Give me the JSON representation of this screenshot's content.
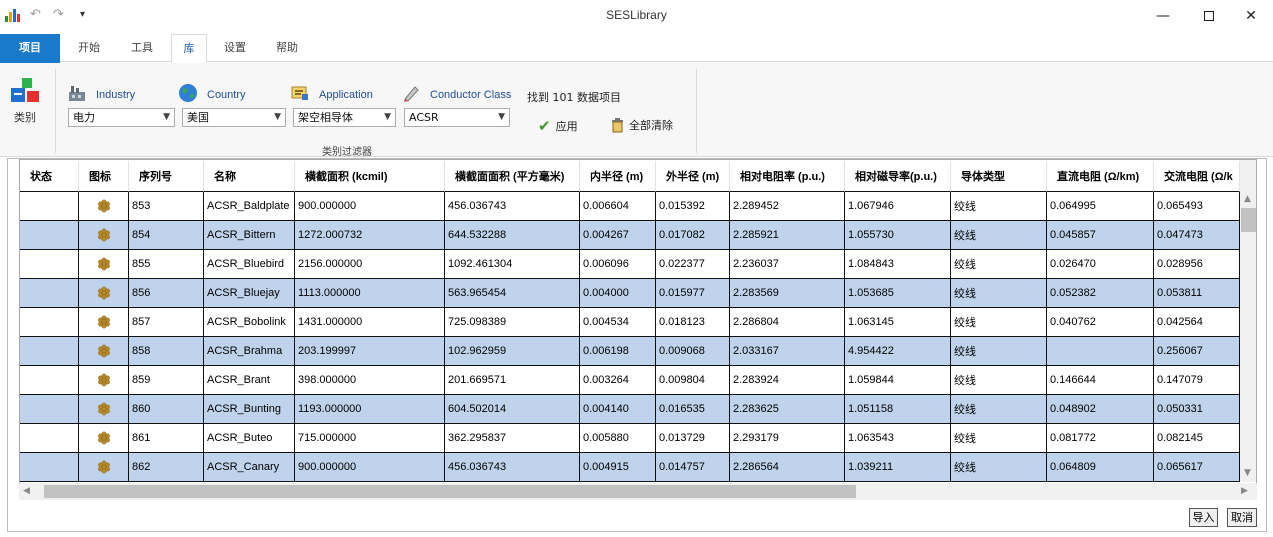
{
  "window": {
    "title": "SESLibrary",
    "minimize_icon": "minimize-icon",
    "maximize_icon": "maximize-icon",
    "close_icon": "close-icon"
  },
  "quick_access": {
    "undo_icon": "undo-icon",
    "redo_icon": "redo-icon",
    "customize_icon": "customize-icon"
  },
  "tabs": [
    {
      "label": "项目"
    },
    {
      "label": "开始"
    },
    {
      "label": "工具"
    },
    {
      "label": "库"
    },
    {
      "label": "设置"
    },
    {
      "label": "帮助"
    }
  ],
  "ribbon": {
    "category_label": "类别",
    "filters": [
      {
        "label": "Industry",
        "value": "电力",
        "icon": "factory-icon"
      },
      {
        "label": "Country",
        "value": "美国",
        "icon": "globe-icon"
      },
      {
        "label": "Application",
        "value": "架空相导体",
        "icon": "application-icon"
      },
      {
        "label": "Conductor Class",
        "value": "ACSR",
        "icon": "pen-icon"
      }
    ],
    "found_text": "找到 101 数据项目",
    "apply_label": "应用",
    "clear_all_label": "全部清除",
    "group_label": "类别过滤器"
  },
  "table": {
    "columns": [
      "状态",
      "图标",
      "序列号",
      "名称",
      "横截面积 (kcmil)",
      "横截面面积 (平方毫米)",
      "内半径 (m)",
      "外半径 (m)",
      "相对电阻率 (p.u.)",
      "相对磁导率(p.u.)",
      "导体类型",
      "直流电阻 (Ω/km)",
      "交流电阻 (Ω/k"
    ],
    "rows": [
      [
        "",
        "",
        "853",
        "ACSR_Baldplate",
        "900.000000",
        "456.036743",
        "0.006604",
        "0.015392",
        "2.289452",
        "1.067946",
        "绞线",
        "0.064995",
        "0.065493"
      ],
      [
        "",
        "",
        "854",
        "ACSR_Bittern",
        "1272.000732",
        "644.532288",
        "0.004267",
        "0.017082",
        "2.285921",
        "1.055730",
        "绞线",
        "0.045857",
        "0.047473"
      ],
      [
        "",
        "",
        "855",
        "ACSR_Bluebird",
        "2156.000000",
        "1092.461304",
        "0.006096",
        "0.022377",
        "2.236037",
        "1.084843",
        "绞线",
        "0.026470",
        "0.028956"
      ],
      [
        "",
        "",
        "856",
        "ACSR_Bluejay",
        "1113.000000",
        "563.965454",
        "0.004000",
        "0.015977",
        "2.283569",
        "1.053685",
        "绞线",
        "0.052382",
        "0.053811"
      ],
      [
        "",
        "",
        "857",
        "ACSR_Bobolink",
        "1431.000000",
        "725.098389",
        "0.004534",
        "0.018123",
        "2.286804",
        "1.063145",
        "绞线",
        "0.040762",
        "0.042564"
      ],
      [
        "",
        "",
        "858",
        "ACSR_Brahma",
        "203.199997",
        "102.962959",
        "0.006198",
        "0.009068",
        "2.033167",
        "4.954422",
        "绞线",
        "",
        "0.256067"
      ],
      [
        "",
        "",
        "859",
        "ACSR_Brant",
        "398.000000",
        "201.669571",
        "0.003264",
        "0.009804",
        "2.283924",
        "1.059844",
        "绞线",
        "0.146644",
        "0.147079"
      ],
      [
        "",
        "",
        "860",
        "ACSR_Bunting",
        "1193.000000",
        "604.502014",
        "0.004140",
        "0.016535",
        "2.283625",
        "1.051158",
        "绞线",
        "0.048902",
        "0.050331"
      ],
      [
        "",
        "",
        "861",
        "ACSR_Buteo",
        "715.000000",
        "362.295837",
        "0.005880",
        "0.013729",
        "2.293179",
        "1.063543",
        "绞线",
        "0.081772",
        "0.082145"
      ],
      [
        "",
        "",
        "862",
        "ACSR_Canary",
        "900.000000",
        "456.036743",
        "0.004915",
        "0.014757",
        "2.286564",
        "1.039211",
        "绞线",
        "0.064809",
        "0.065617"
      ]
    ]
  },
  "footer": {
    "import_label": "导入",
    "cancel_label": "取消"
  },
  "colors": {
    "accent": "#1979ca",
    "row_alt": "#bfd3ec",
    "label_blue": "#1e4f9b",
    "conductor_icon": "#b8892a"
  }
}
